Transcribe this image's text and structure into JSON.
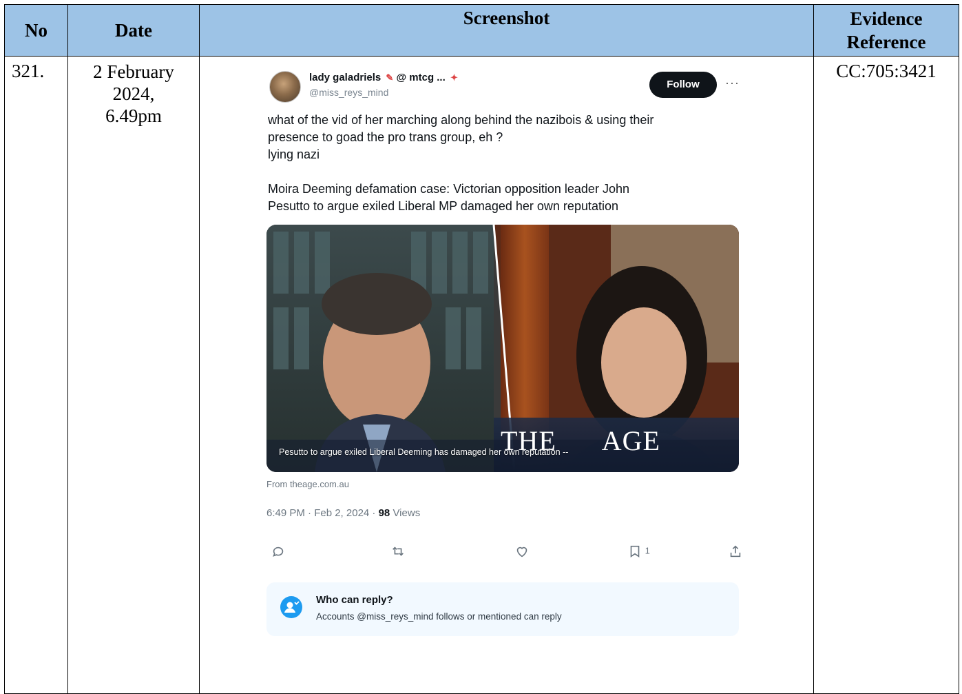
{
  "headers": {
    "no": "No",
    "date": "Date",
    "screenshot": "Screenshot",
    "evidence_ref": "Evidence Reference"
  },
  "row": {
    "no": "321.",
    "date_lines": [
      "2 February",
      "2024,",
      "6.49pm"
    ],
    "evidence_ref": "CC:705:3421"
  },
  "tweet": {
    "display_name": "lady galadriels",
    "name_suffix": "@ mtcg ...",
    "handle": "@miss_reys_mind",
    "follow_label": "Follow",
    "more_label": "···",
    "text_lines": [
      "what of the vid of her marching along behind the nazibois & using their",
      "presence to goad the pro trans group, eh ?",
      "lying nazi"
    ],
    "headline_lines": [
      "Moira Deeming defamation case: Victorian opposition leader John",
      "Pesutto to argue exiled Liberal MP damaged her own reputation"
    ],
    "media": {
      "caption": "Pesutto to argue exiled Liberal Deeming has damaged her own reputation --",
      "brand_left": "THE",
      "brand_right": "AGE"
    },
    "source": "From theage.com.au",
    "meta_time": "6:49 PM · Feb 2, 2024 · ",
    "meta_views_count": "98",
    "meta_views_label": " Views",
    "bookmark_count": "1",
    "who_can_reply_title": "Who can reply?",
    "who_can_reply_sub": "Accounts @miss_reys_mind follows or mentioned can reply",
    "icons": [
      "reply-icon",
      "retweet-icon",
      "like-icon",
      "bookmark-icon",
      "share-icon",
      "person-icon"
    ]
  },
  "colors": {
    "header_bg": "#9dc3e6",
    "follow_bg": "#0f1419",
    "reply_box_bg": "#f2f9ff",
    "reply_icon_bg": "#1d9bf0"
  }
}
